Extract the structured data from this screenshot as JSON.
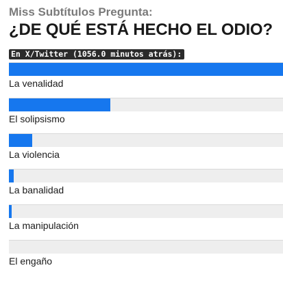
{
  "header": {
    "subtitle": "Miss Subtítulos Pregunta:",
    "title": "¿DE QUÉ ESTÁ HECHO EL ODIO?"
  },
  "source": {
    "label": "En X/Twitter (1056.0 minutos atrás):"
  },
  "colors": {
    "bar_fill": "#1677ee",
    "bar_track": "#eeeeee",
    "badge_bg": "#2b2b2b"
  },
  "poll": {
    "options": [
      {
        "label": "La venalidad",
        "fraction": 1.0
      },
      {
        "label": "El solipsismo",
        "fraction": 0.37
      },
      {
        "label": "La violencia",
        "fraction": 0.085
      },
      {
        "label": "La banalidad",
        "fraction": 0.018
      },
      {
        "label": "La manipulación",
        "fraction": 0.01
      },
      {
        "label": "El engaño",
        "fraction": 0.0
      }
    ]
  }
}
